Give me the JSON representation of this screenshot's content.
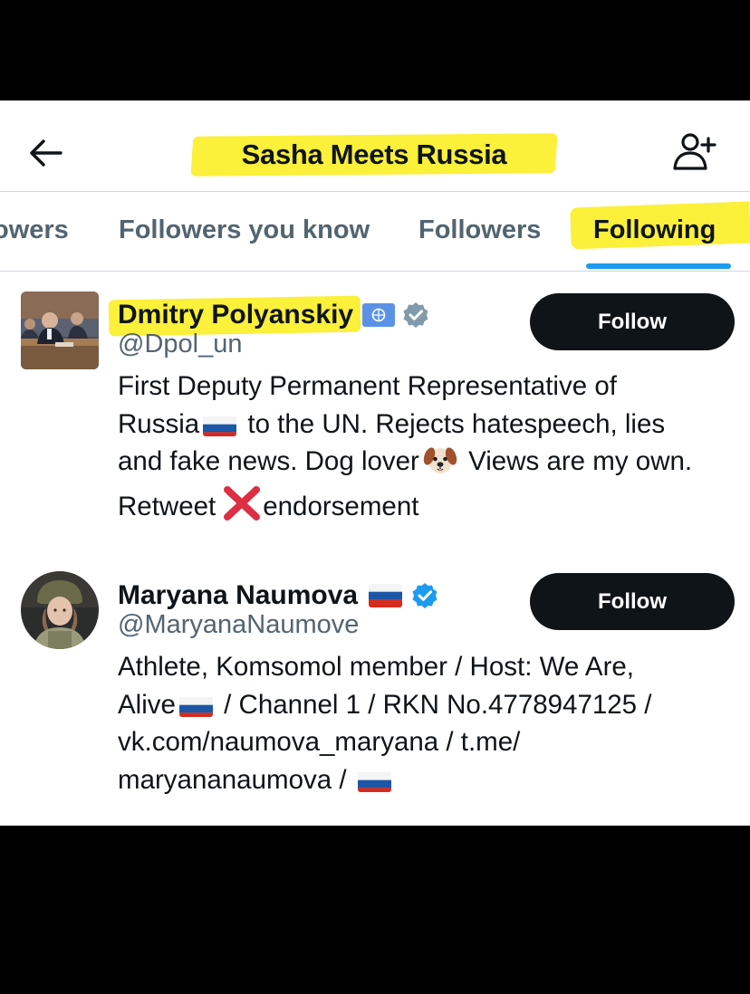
{
  "header": {
    "title": "Sasha Meets Russia",
    "back_icon": "arrow-left-icon",
    "add_user_icon": "add-user-icon"
  },
  "tabs": [
    {
      "label": "Followers",
      "visible_label": "owers",
      "active": false
    },
    {
      "label": "Followers you know",
      "active": false
    },
    {
      "label": "Followers",
      "active": false
    },
    {
      "label": "Following",
      "active": true
    }
  ],
  "users": [
    {
      "name": "Dmitry Polyanskiy",
      "handle": "@Dpol_un",
      "badges": [
        "un-flag-icon",
        "verified-gray-icon"
      ],
      "bio": {
        "l1": "First Deputy Permanent Representative of",
        "l2a": "Russia",
        "l2b": " to the UN. Rejects hatespeech, lies",
        "l3a": "and fake news. Dog lover",
        "l3b": " Views are my own.",
        "l4a": "Retweet",
        "l4b": "endorsement"
      },
      "follow_label": "Follow"
    },
    {
      "name": "Maryana Naumova",
      "handle": "@MaryanaNaumove",
      "badges": [
        "russia-flag-icon",
        "verified-blue-icon"
      ],
      "bio": {
        "l1": "Athlete, Komsomol member / Host: We Are,",
        "l2a": "Alive",
        "l2b": " / Channel 1 / RKN No.4778947125 /",
        "l3": "vk.com/naumova_maryana / t.me/",
        "l4": "maryananaumova /"
      },
      "follow_label": "Follow"
    }
  ],
  "colors": {
    "highlight": "#fbf03a",
    "accent": "#1d9bf0",
    "text_primary": "#0f1419",
    "text_secondary": "#536471",
    "verified_gray": "#829aab",
    "verified_blue": "#1d9bf0"
  }
}
